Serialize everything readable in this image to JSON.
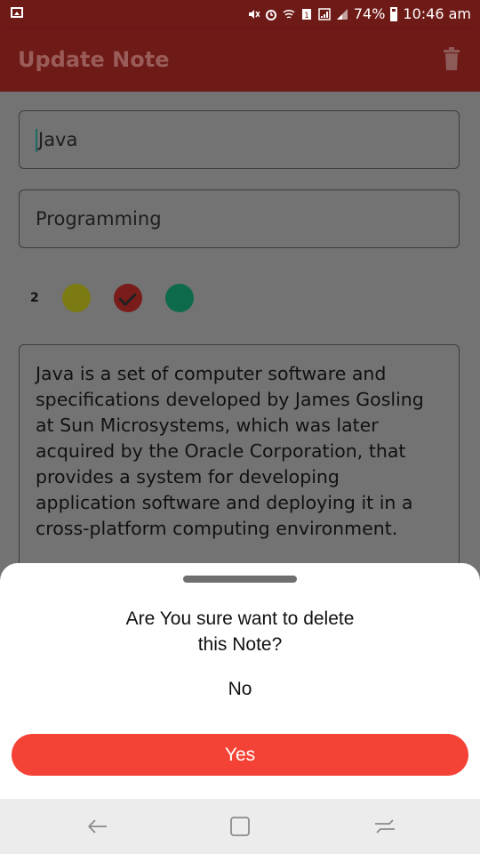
{
  "status_bar": {
    "battery": "74%",
    "time": "10:46 am"
  },
  "app_bar": {
    "title": "Update Note",
    "delete_icon": "trash-icon"
  },
  "note": {
    "title": "Java",
    "category": "Programming",
    "priority_count": "2",
    "colors": [
      {
        "name": "yellow",
        "hex": "#7c7a12",
        "selected": false
      },
      {
        "name": "red",
        "hex": "#7a1c1a",
        "selected": true
      },
      {
        "name": "green",
        "hex": "#0d6b4b",
        "selected": false
      }
    ],
    "description": "Java is a set of computer software and specifications developed by James Gosling at Sun Microsystems, which was later acquired by the Oracle Corporation, that provides a system for developing application software and deploying it in a cross-platform computing environment."
  },
  "dialog": {
    "question_line1": "Are You sure want to delete",
    "question_line2": "this Note?",
    "no_label": "No",
    "yes_label": "Yes",
    "yes_color": "#f44336"
  },
  "nav": {
    "back": "back-icon",
    "home": "home-icon",
    "recents": "recents-icon"
  }
}
